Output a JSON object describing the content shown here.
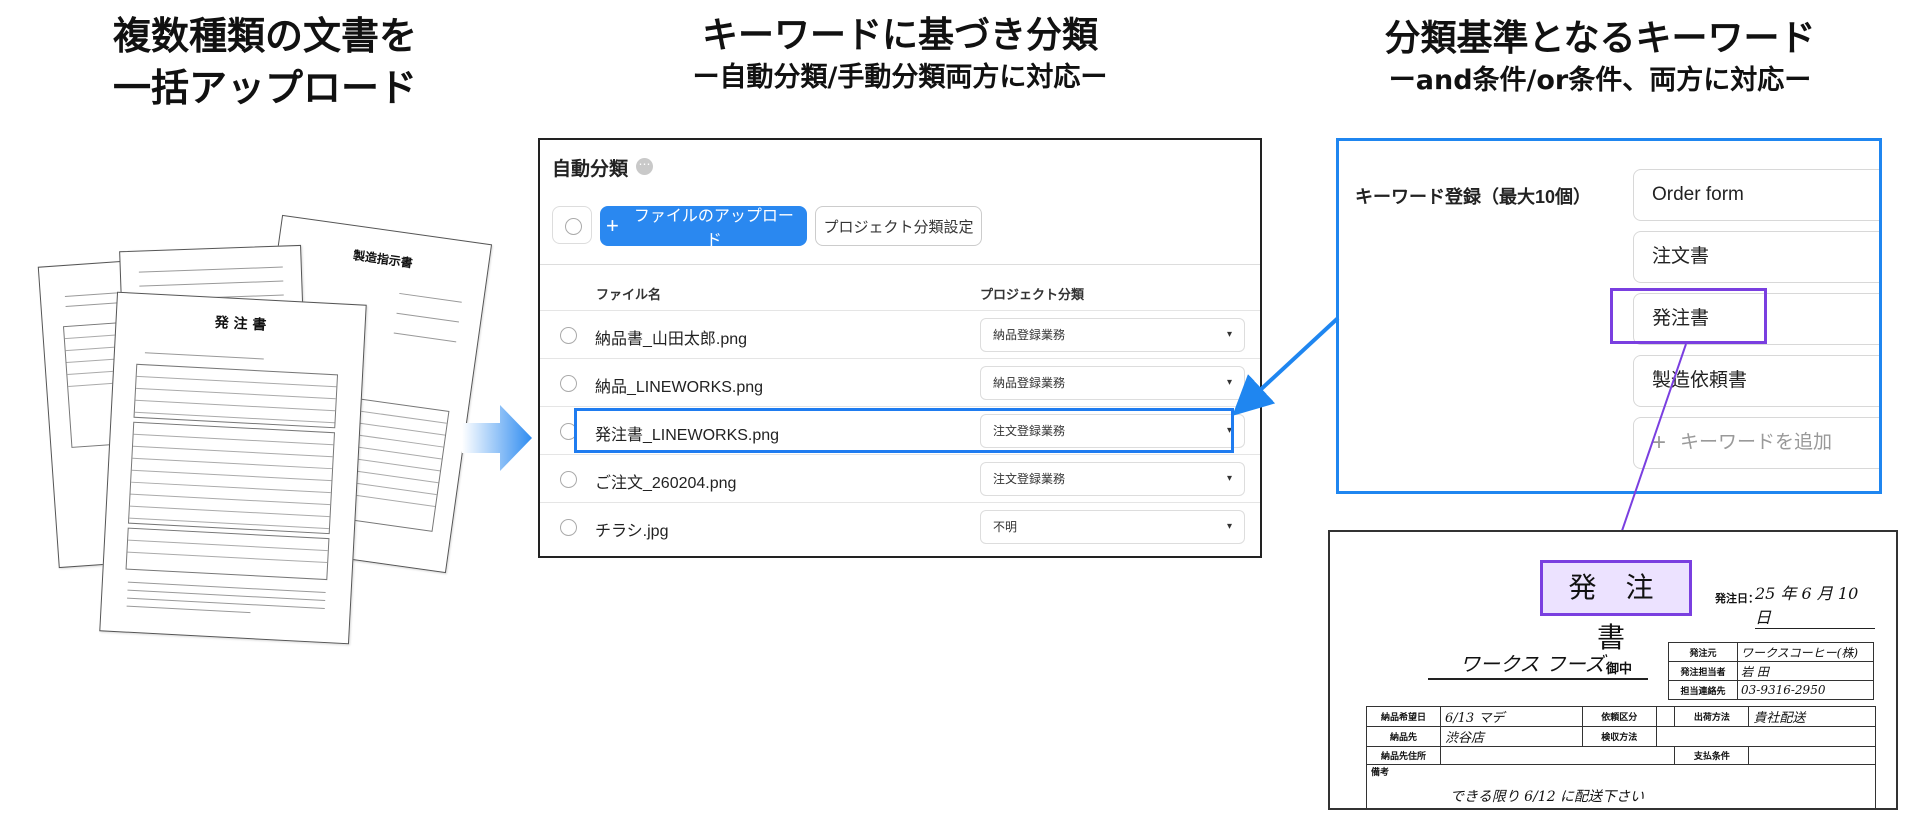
{
  "headings": {
    "left": {
      "line1": "複数種類の文書を",
      "line2": "一括アップロード"
    },
    "center": {
      "line1": "キーワードに基づき分類",
      "line2": "ー自動分類/手動分類両方に対応ー"
    },
    "right": {
      "line1": "分類基準となるキーワード",
      "line2": "ーand条件/or条件、両方に対応ー"
    }
  },
  "illustration": {
    "front_doc_title": "発 注 書",
    "back_doc_title": "製造指示書"
  },
  "app": {
    "title": "自動分類",
    "info_icon": "⋯",
    "upload_button": {
      "icon": "+",
      "label": "ファイルのアップロード"
    },
    "settings_button": "プロジェクト分類設定",
    "columns": {
      "file": "ファイル名",
      "project": "プロジェクト分類"
    },
    "rows": [
      {
        "file": "納品書_山田太郎.png",
        "project": "納品登録業務"
      },
      {
        "file": "納品_LINEWORKS.png",
        "project": "納品登録業務"
      },
      {
        "file": "発注書_LINEWORKS.png",
        "project": "注文登録業務"
      },
      {
        "file": "ご注文_260204.png",
        "project": "注文登録業務"
      },
      {
        "file": "チラシ.jpg",
        "project": "不明"
      }
    ],
    "highlighted_row_index": 2,
    "select_caret": "▾"
  },
  "keywords": {
    "label": "キーワード登録（最大10個）",
    "items": [
      "Order form",
      "注文書",
      "発注書",
      "製造依頼書"
    ],
    "add_placeholder": "キーワードを追加",
    "add_icon": "+",
    "highlighted_index": 2
  },
  "order_doc": {
    "title": "発 注 書",
    "date_label": "発注日：",
    "date_value": "25 年 6 月 10 日",
    "customer": "ワークス フーズ",
    "honorific": "御中",
    "issuer": [
      {
        "label": "発注元",
        "value": "ワークスコーヒー(株)"
      },
      {
        "label": "発注担当者",
        "value": "岩 田"
      },
      {
        "label": "担当連絡先",
        "value": "03-9316-2950"
      }
    ],
    "delivery": {
      "desired_date_label": "納品希望日",
      "desired_date_value": "6/13 マデ",
      "request_type_label": "依頼区分",
      "shipping_method_label": "出荷方法",
      "shipping_method_value": "貴社配送",
      "destination_label": "納品先",
      "destination_value": "渋谷店",
      "inspection_label": "検収方法",
      "address_label": "納品先住所",
      "payment_label": "支払条件",
      "remarks_label": "備考",
      "remarks_value": "できる限り 6/12 に配送下さい"
    }
  },
  "colors": {
    "accent_blue": "#1f86f0",
    "button_blue": "#2a88f0",
    "keyword_highlight": "#7a3fe0",
    "title_box_fill": "#ece2ff"
  }
}
